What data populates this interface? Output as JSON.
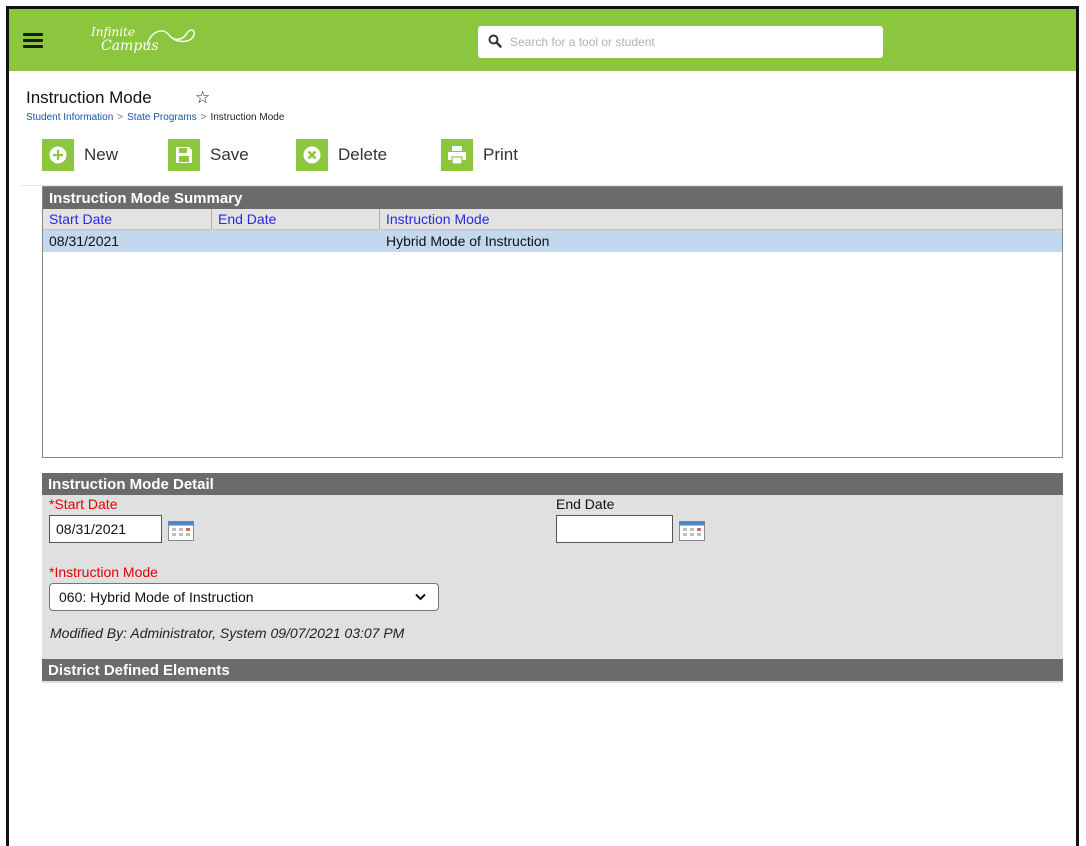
{
  "header": {
    "logo_line1": "Infinite",
    "logo_line2": "Campus",
    "search_placeholder": "Search for a tool or student",
    "accent_color": "#8cc63f"
  },
  "page": {
    "title": "Instruction Mode",
    "favorite_icon": "star-outline-icon",
    "breadcrumb": [
      "Student Information",
      "State Programs",
      "Instruction Mode"
    ],
    "breadcrumb_separator": ">"
  },
  "toolbar": {
    "new_label": "New",
    "save_label": "Save",
    "delete_label": "Delete",
    "print_label": "Print"
  },
  "summary": {
    "title": "Instruction Mode Summary",
    "columns": [
      "Start Date",
      "End Date",
      "Instruction Mode"
    ],
    "rows": [
      {
        "start_date": "08/31/2021",
        "end_date": "",
        "instruction_mode": "Hybrid Mode of Instruction"
      }
    ]
  },
  "detail": {
    "title": "Instruction Mode Detail",
    "start_date_label": "*Start Date",
    "start_date_value": "08/31/2021",
    "end_date_label": "End Date",
    "end_date_value": "",
    "instruction_mode_label": "*Instruction Mode",
    "instruction_mode_value": "060: Hybrid Mode of Instruction",
    "modified_by": "Modified By: Administrator, System 09/07/2021 03:07 PM"
  },
  "district": {
    "title": "District Defined Elements"
  }
}
